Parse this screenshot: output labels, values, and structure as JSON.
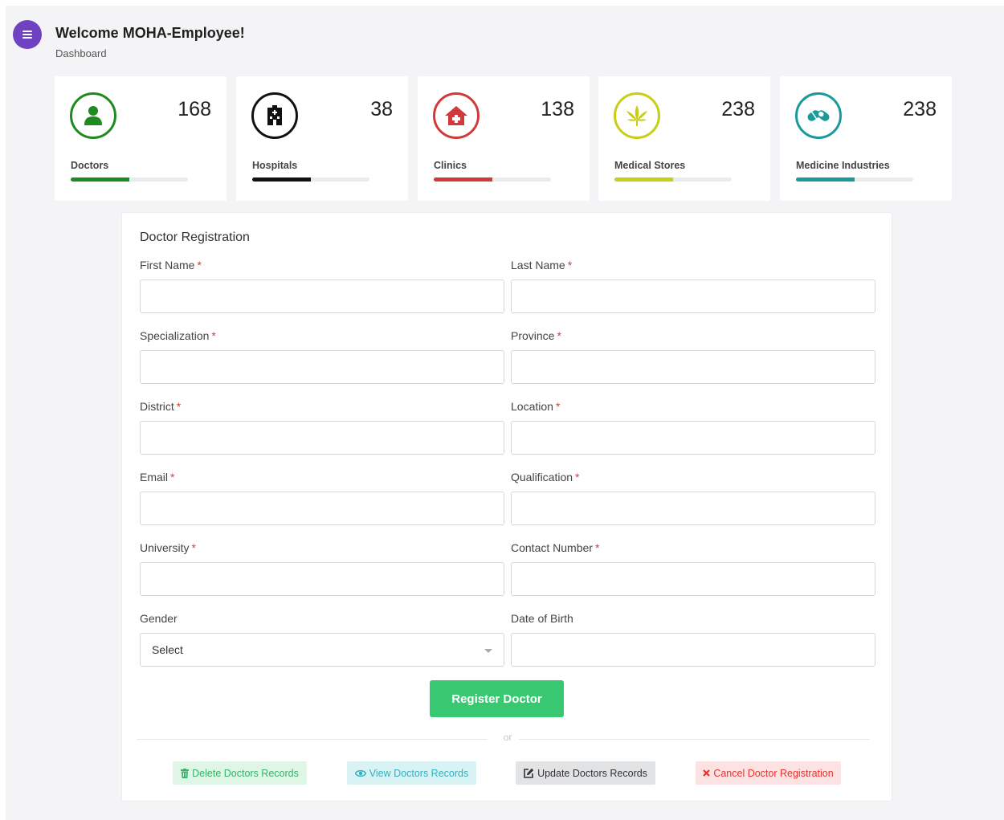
{
  "header": {
    "welcome": "Welcome MOHA-Employee!",
    "breadcrumb": "Dashboard"
  },
  "stats": [
    {
      "label": "Doctors",
      "count": "168",
      "color": "#1f8a1f",
      "icon": "user-icon",
      "progress": 0.5
    },
    {
      "label": "Hospitals",
      "count": "38",
      "color": "#111111",
      "icon": "hospital-building-icon",
      "progress": 0.5
    },
    {
      "label": "Clinics",
      "count": "138",
      "color": "#d13a3a",
      "icon": "clinic-house-icon",
      "progress": 0.5
    },
    {
      "label": "Medical Stores",
      "count": "238",
      "color": "#c6cf14",
      "icon": "leaf-icon",
      "progress": 0.5
    },
    {
      "label": "Medicine Industries",
      "count": "238",
      "color": "#1a9a9a",
      "icon": "pills-icon",
      "progress": 0.5
    }
  ],
  "form": {
    "title": "Doctor Registration",
    "required_mark": "*",
    "fields": {
      "first_name": "First Name",
      "last_name": "Last Name",
      "specialization": "Specialization",
      "province": "Province",
      "district": "District",
      "location": "Location",
      "email": "Email",
      "qualification": "Qualification",
      "university": "University",
      "contact_number": "Contact Number",
      "gender": "Gender",
      "date_of_birth": "Date of Birth"
    },
    "gender_selected": "Select",
    "submit_label": "Register Doctor",
    "or_text": "or"
  },
  "actions": {
    "delete": {
      "label": "Delete Doctors Records",
      "icon": "trash-icon",
      "bg": "#dff5e6",
      "fg": "#38b36a"
    },
    "view": {
      "label": "View Doctors Records",
      "icon": "eye-icon",
      "bg": "#d9f3f5",
      "fg": "#2fb0c0"
    },
    "update": {
      "label": "Update Doctors Records",
      "icon": "edit-icon",
      "bg": "#e2e3e5",
      "fg": "#333333"
    },
    "cancel": {
      "label": "Cancel Doctor Registration",
      "icon": "close-icon",
      "bg": "#fde2e4",
      "fg": "#e3342f"
    }
  }
}
